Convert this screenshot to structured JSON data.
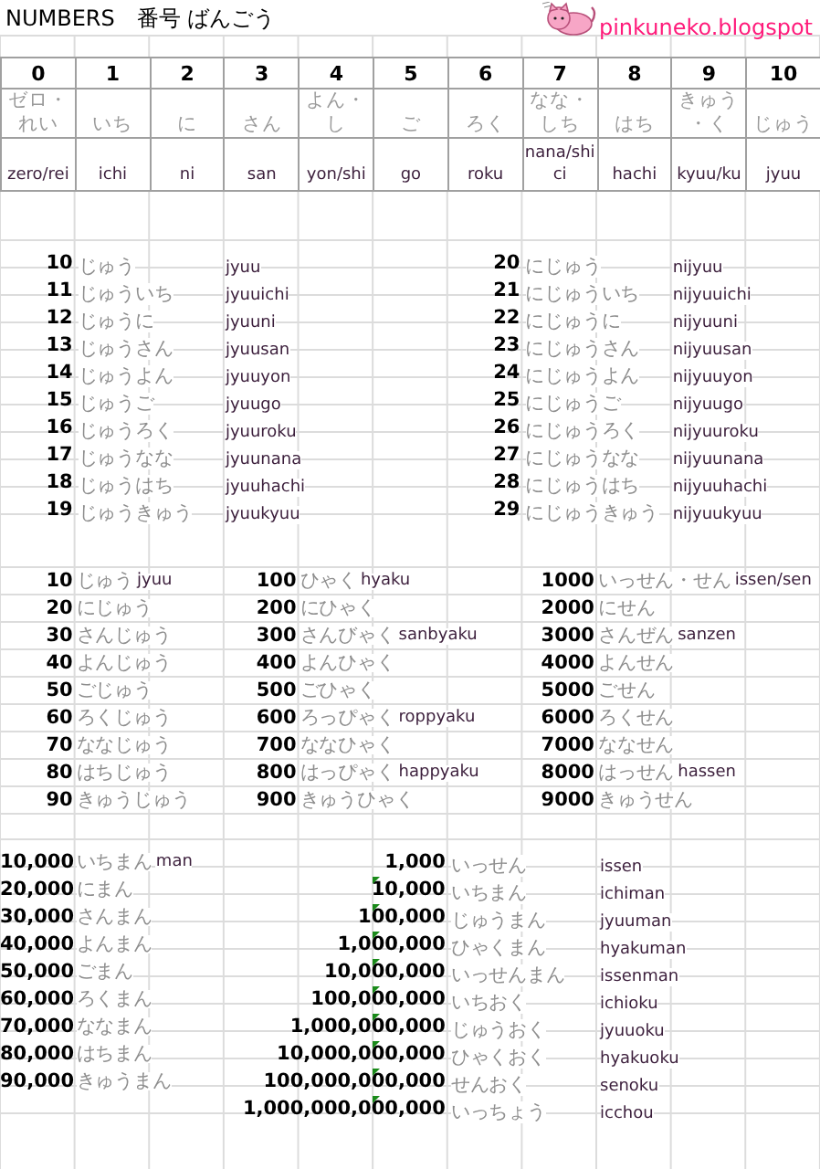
{
  "title": "NUMBERS　番号 ばんごう",
  "logo": {
    "text": "pinkuneko.blogspot"
  },
  "digits": [
    {
      "number": "0",
      "kana": "ゼロ・れい",
      "romaji": "zero/rei"
    },
    {
      "number": "1",
      "kana": "いち",
      "romaji": "ichi"
    },
    {
      "number": "2",
      "kana": "に",
      "romaji": "ni"
    },
    {
      "number": "3",
      "kana": "さん",
      "romaji": "san"
    },
    {
      "number": "4",
      "kana": "よん・し",
      "romaji": "yon/shi"
    },
    {
      "number": "5",
      "kana": "ご",
      "romaji": "go"
    },
    {
      "number": "6",
      "kana": "ろく",
      "romaji": "roku"
    },
    {
      "number": "7",
      "kana": "なな・しち",
      "romaji": "nana/shici"
    },
    {
      "number": "8",
      "kana": "はち",
      "romaji": "hachi"
    },
    {
      "number": "9",
      "kana": "きゅう・く",
      "romaji": "kyuu/ku"
    },
    {
      "number": "10",
      "kana": "じゅう",
      "romaji": "jyuu"
    }
  ],
  "teens": [
    {
      "number": "10",
      "kana": "じゅう",
      "romaji": "jyuu"
    },
    {
      "number": "11",
      "kana": "じゅういち",
      "romaji": "jyuuichi"
    },
    {
      "number": "12",
      "kana": "じゅうに",
      "romaji": "jyuuni"
    },
    {
      "number": "13",
      "kana": "じゅうさん",
      "romaji": "jyuusan"
    },
    {
      "number": "14",
      "kana": "じゅうよん",
      "romaji": "jyuuyon"
    },
    {
      "number": "15",
      "kana": "じゅうご",
      "romaji": "jyuugo"
    },
    {
      "number": "16",
      "kana": "じゅうろく",
      "romaji": "jyuuroku"
    },
    {
      "number": "17",
      "kana": "じゅうなな",
      "romaji": "jyuunana"
    },
    {
      "number": "18",
      "kana": "じゅうはち",
      "romaji": "jyuuhachi"
    },
    {
      "number": "19",
      "kana": "じゅうきゅう",
      "romaji": "jyuukyuu"
    }
  ],
  "twenties": [
    {
      "number": "20",
      "kana": "にじゅう",
      "romaji": "nijyuu"
    },
    {
      "number": "21",
      "kana": "にじゅういち",
      "romaji": "nijyuuichi"
    },
    {
      "number": "22",
      "kana": "にじゅうに",
      "romaji": "nijyuuni"
    },
    {
      "number": "23",
      "kana": "にじゅうさん",
      "romaji": "nijyuusan"
    },
    {
      "number": "24",
      "kana": "にじゅうよん",
      "romaji": "nijyuuyon"
    },
    {
      "number": "25",
      "kana": "にじゅうご",
      "romaji": "nijyuugo"
    },
    {
      "number": "26",
      "kana": "にじゅうろく",
      "romaji": "nijyuuroku"
    },
    {
      "number": "27",
      "kana": "にじゅうなな",
      "romaji": "nijyuunana"
    },
    {
      "number": "28",
      "kana": "にじゅうはち",
      "romaji": "nijyuuhachi"
    },
    {
      "number": "29",
      "kana": "にじゅうきゅう",
      "romaji": "nijyuukyuu"
    }
  ],
  "tens": [
    {
      "number": "10",
      "kana": "じゅう",
      "romaji": "jyuu"
    },
    {
      "number": "20",
      "kana": "にじゅう"
    },
    {
      "number": "30",
      "kana": "さんじゅう"
    },
    {
      "number": "40",
      "kana": "よんじゅう"
    },
    {
      "number": "50",
      "kana": "ごじゅう"
    },
    {
      "number": "60",
      "kana": "ろくじゅう"
    },
    {
      "number": "70",
      "kana": "ななじゅう"
    },
    {
      "number": "80",
      "kana": "はちじゅう"
    },
    {
      "number": "90",
      "kana": "きゅうじゅう"
    }
  ],
  "hundreds": [
    {
      "number": "100",
      "kana": "ひゃく",
      "romaji": "hyaku"
    },
    {
      "number": "200",
      "kana": "にひゃく"
    },
    {
      "number": "300",
      "kana": "さんびゃく",
      "romaji": "sanbyaku"
    },
    {
      "number": "400",
      "kana": "よんひゃく"
    },
    {
      "number": "500",
      "kana": "ごひゃく"
    },
    {
      "number": "600",
      "kana": "ろっぴゃく",
      "romaji": "roppyaku"
    },
    {
      "number": "700",
      "kana": "ななひゃく"
    },
    {
      "number": "800",
      "kana": "はっぴゃく",
      "romaji": "happyaku"
    },
    {
      "number": "900",
      "kana": "きゅうひゃく"
    }
  ],
  "thousands": [
    {
      "number": "1000",
      "kana": "いっせん・せん",
      "romaji": "issen/sen"
    },
    {
      "number": "2000",
      "kana": "にせん"
    },
    {
      "number": "3000",
      "kana": "さんぜん",
      "romaji": "sanzen"
    },
    {
      "number": "4000",
      "kana": "よんせん"
    },
    {
      "number": "5000",
      "kana": "ごせん"
    },
    {
      "number": "6000",
      "kana": "ろくせん"
    },
    {
      "number": "7000",
      "kana": "ななせん"
    },
    {
      "number": "8000",
      "kana": "はっせん",
      "romaji": "hassen"
    },
    {
      "number": "9000",
      "kana": "きゅうせん"
    }
  ],
  "ten_thousands": [
    {
      "number": "10,000",
      "kana": "いちまん",
      "romaji": "man"
    },
    {
      "number": "20,000",
      "kana": "にまん"
    },
    {
      "number": "30,000",
      "kana": "さんまん"
    },
    {
      "number": "40,000",
      "kana": "よんまん"
    },
    {
      "number": "50,000",
      "kana": "ごまん"
    },
    {
      "number": "60,000",
      "kana": "ろくまん"
    },
    {
      "number": "70,000",
      "kana": "ななまん"
    },
    {
      "number": "80,000",
      "kana": "はちまん"
    },
    {
      "number": "90,000",
      "kana": "きゅうまん"
    }
  ],
  "powers": [
    {
      "number": "1,000",
      "kana": "いっせん",
      "romaji": "issen",
      "flagged": false
    },
    {
      "number": "10,000",
      "kana": "いちまん",
      "romaji": "ichiman",
      "flagged": true
    },
    {
      "number": "100,000",
      "kana": "じゅうまん",
      "romaji": "jyuuman",
      "flagged": true
    },
    {
      "number": "1,000,000",
      "kana": "ひゃくまん",
      "romaji": "hyakuman",
      "flagged": true
    },
    {
      "number": "10,000,000",
      "kana": "いっせんまん",
      "romaji": "issenman",
      "flagged": true
    },
    {
      "number": "100,000,000",
      "kana": "いちおく",
      "romaji": "ichioku",
      "flagged": true
    },
    {
      "number": "1,000,000,000",
      "kana": "じゅうおく",
      "romaji": "jyuuoku",
      "flagged": true
    },
    {
      "number": "10,000,000,000",
      "kana": "ひゃくおく",
      "romaji": "hyakuoku",
      "flagged": true
    },
    {
      "number": "100,000,000,000",
      "kana": "せんおく",
      "romaji": "senoku",
      "flagged": true
    },
    {
      "number": "1,000,000,000,000",
      "kana": "いっちょう",
      "romaji": "icchou",
      "flagged": true
    }
  ]
}
